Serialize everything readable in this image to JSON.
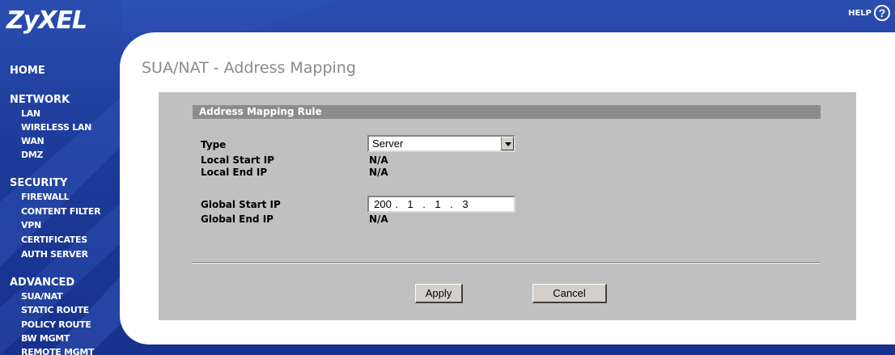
{
  "brand": {
    "logo": "ZyXEL"
  },
  "help": {
    "label": "HELP",
    "icon": "help-circle-icon",
    "glyph": "?"
  },
  "nav": {
    "home": "HOME",
    "network": {
      "label": "NETWORK",
      "items": [
        "LAN",
        "WIRELESS LAN",
        "WAN",
        "DMZ"
      ]
    },
    "security": {
      "label": "SECURITY",
      "items": [
        "FIREWALL",
        "CONTENT FILTER",
        "VPN",
        "CERTIFICATES",
        "AUTH SERVER"
      ]
    },
    "advanced": {
      "label": "ADVANCED",
      "items": [
        "SUA/NAT",
        "STATIC ROUTE",
        "POLICY ROUTE",
        "BW MGMT",
        "REMOTE MGMT"
      ]
    }
  },
  "page": {
    "title": "SUA/NAT - Address Mapping"
  },
  "form": {
    "section_title": "Address Mapping Rule",
    "type_label": "Type",
    "type_value": "Server",
    "local_start_label": "Local Start IP",
    "local_start_value": "N/A",
    "local_end_label": "Local End IP",
    "local_end_value": "N/A",
    "global_start_label": "Global Start IP",
    "global_start_ip": [
      "200",
      "1",
      "1",
      "3"
    ],
    "global_end_label": "Global End IP",
    "global_end_value": "N/A",
    "apply_label": "Apply",
    "cancel_label": "Cancel"
  },
  "colors": {
    "frame_blue": "#1c3a98",
    "panel_grey": "#c0c0c0",
    "section_bar": "#8c8c8c"
  }
}
